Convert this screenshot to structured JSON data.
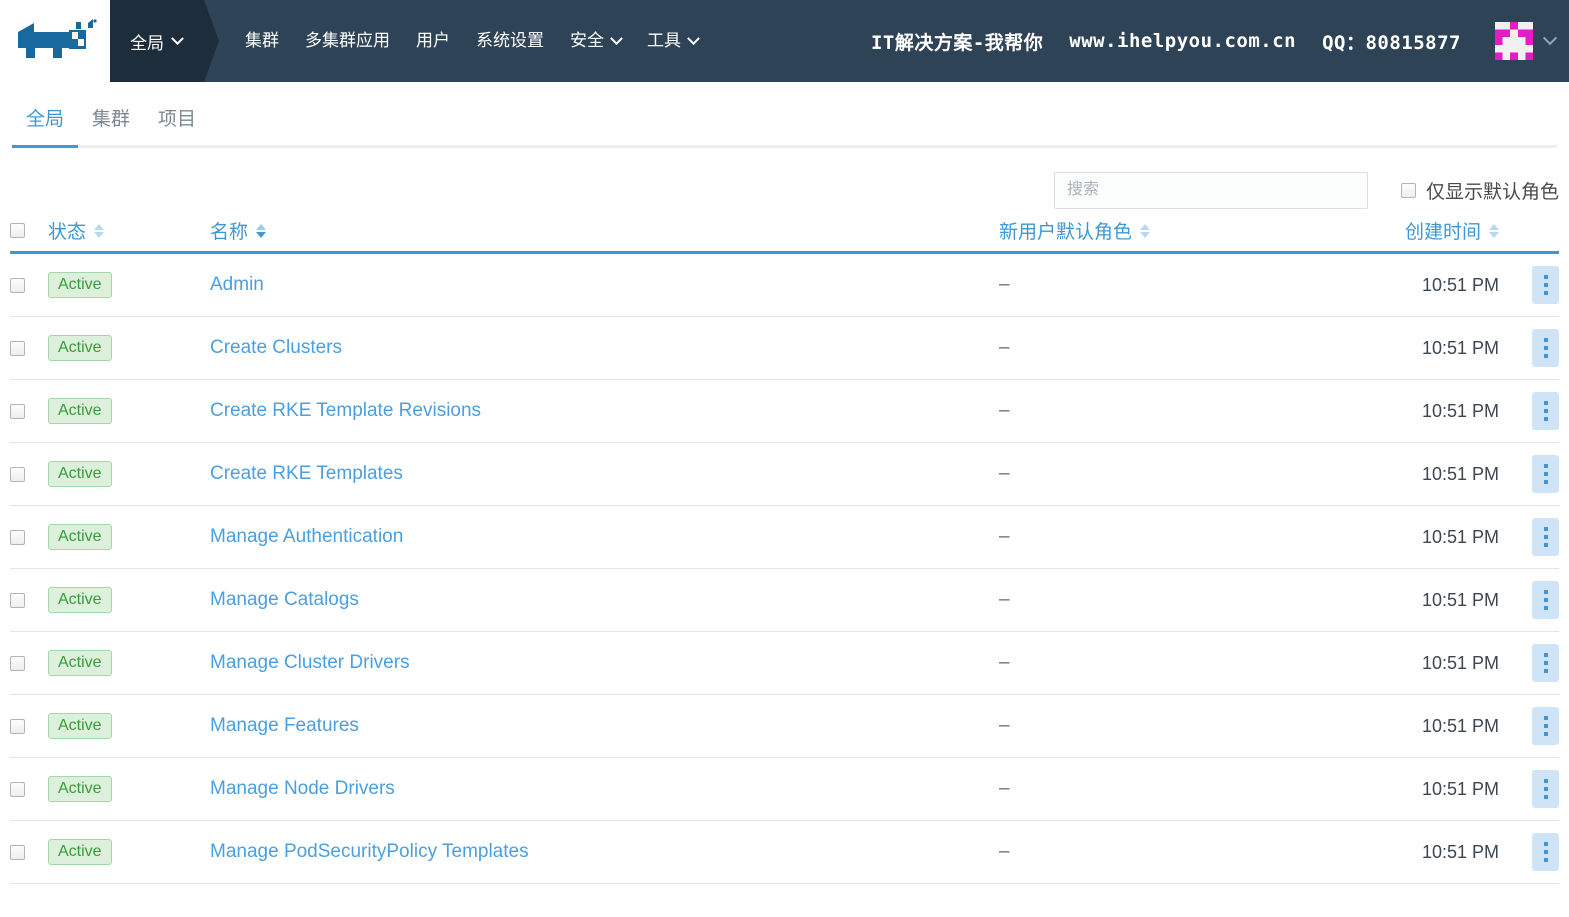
{
  "header": {
    "logo_name": "rancher-cow-logo",
    "context_switcher": {
      "label": "全局",
      "icon": "chevron-down-icon"
    },
    "nav_items": [
      {
        "label": "集群",
        "has_caret": false
      },
      {
        "label": "多集群应用",
        "has_caret": false
      },
      {
        "label": "用户",
        "has_caret": false
      },
      {
        "label": "系统设置",
        "has_caret": false
      },
      {
        "label": "安全",
        "has_caret": true
      },
      {
        "label": "工具",
        "has_caret": true
      }
    ],
    "promo": {
      "slogan": "IT解决方案-我帮你",
      "website": "www.ihelpyou.com.cn",
      "qq": "QQ：80815877"
    },
    "user": {
      "avatar_name": "identicon-avatar",
      "caret_icon": "chevron-down-icon"
    },
    "colors": {
      "navbar_bg": "#2e4356",
      "context_bg": "#1e2d3b",
      "logo_blue": "#17699e"
    }
  },
  "tabs": [
    {
      "label": "全局",
      "active": true
    },
    {
      "label": "集群",
      "active": false
    },
    {
      "label": "项目",
      "active": false
    }
  ],
  "toolbar": {
    "search_placeholder": "搜索",
    "search_value": "",
    "default_roles_only_label": "仅显示默认角色",
    "default_roles_only_checked": false
  },
  "table": {
    "select_all_checked": false,
    "columns": [
      {
        "key": "state",
        "label": "状态",
        "sorted": false
      },
      {
        "key": "name",
        "label": "名称",
        "sorted": true
      },
      {
        "key": "default_role",
        "label": "新用户默认角色",
        "sorted": false
      },
      {
        "key": "created",
        "label": "创建时间",
        "sorted": false
      }
    ],
    "action_icon": "kebab-menu-icon",
    "rows": [
      {
        "checked": false,
        "state": "Active",
        "name": "Admin",
        "default_role": "–",
        "created": "10:51 PM"
      },
      {
        "checked": false,
        "state": "Active",
        "name": "Create Clusters",
        "default_role": "–",
        "created": "10:51 PM"
      },
      {
        "checked": false,
        "state": "Active",
        "name": "Create RKE Template Revisions",
        "default_role": "–",
        "created": "10:51 PM"
      },
      {
        "checked": false,
        "state": "Active",
        "name": "Create RKE Templates",
        "default_role": "–",
        "created": "10:51 PM"
      },
      {
        "checked": false,
        "state": "Active",
        "name": "Manage Authentication",
        "default_role": "–",
        "created": "10:51 PM"
      },
      {
        "checked": false,
        "state": "Active",
        "name": "Manage Catalogs",
        "default_role": "–",
        "created": "10:51 PM"
      },
      {
        "checked": false,
        "state": "Active",
        "name": "Manage Cluster Drivers",
        "default_role": "–",
        "created": "10:51 PM"
      },
      {
        "checked": false,
        "state": "Active",
        "name": "Manage Features",
        "default_role": "–",
        "created": "10:51 PM"
      },
      {
        "checked": false,
        "state": "Active",
        "name": "Manage Node Drivers",
        "default_role": "–",
        "created": "10:51 PM"
      },
      {
        "checked": false,
        "state": "Active",
        "name": "Manage PodSecurityPolicy Templates",
        "default_role": "–",
        "created": "10:51 PM"
      }
    ]
  },
  "colors": {
    "accent": "#3d98d3",
    "link": "#4b9fe0",
    "badge_bg": "#dcf0dc",
    "badge_text": "#3a9b3a",
    "avatar_pink": "#e01ec4"
  }
}
